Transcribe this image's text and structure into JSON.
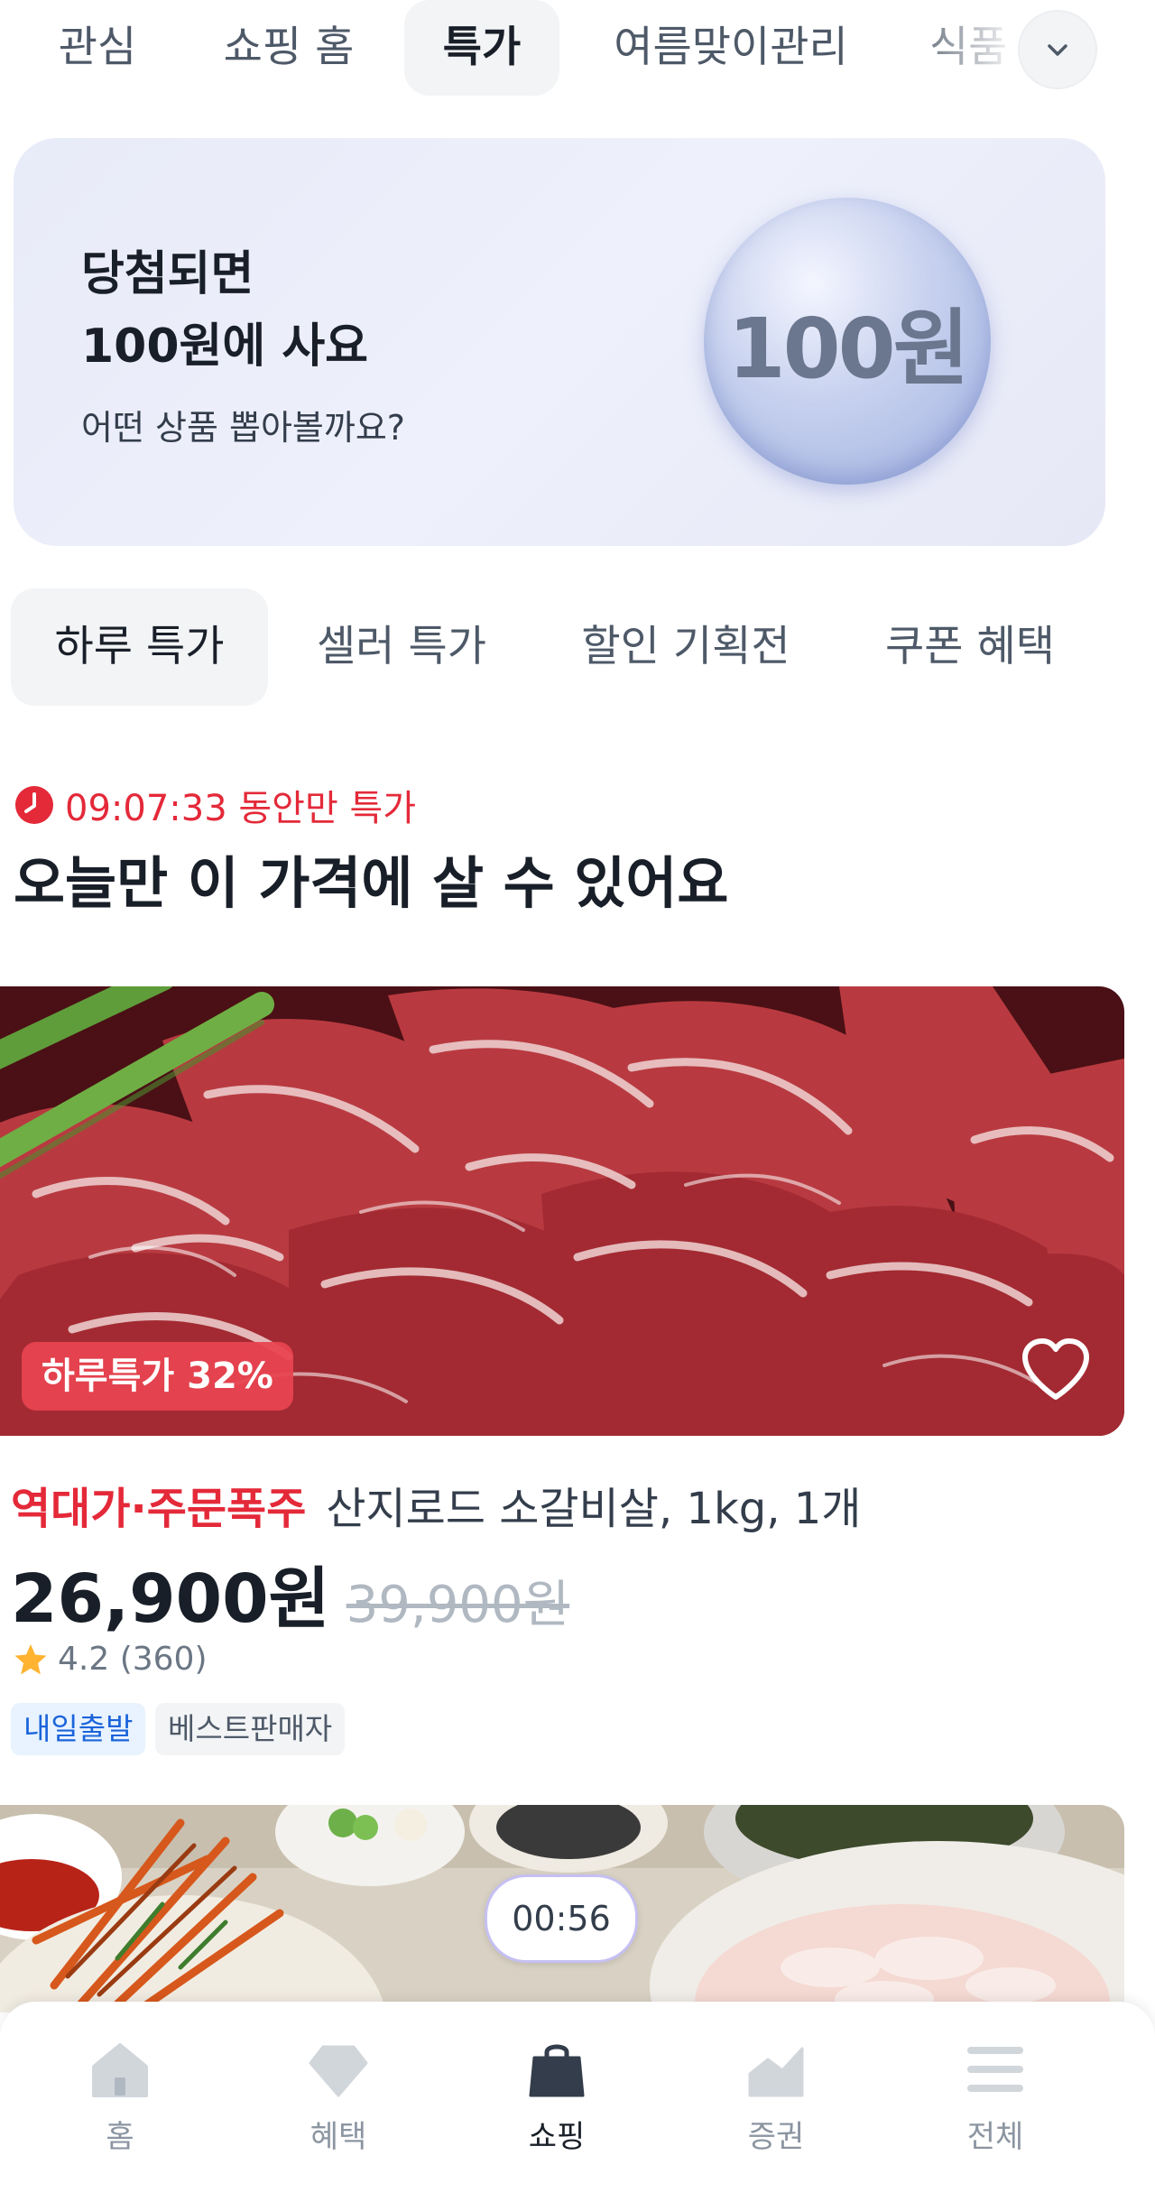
{
  "top_tabs": [
    {
      "label": "관심"
    },
    {
      "label": "쇼핑 홈"
    },
    {
      "label": "특가"
    },
    {
      "label": "여름맞이관리"
    },
    {
      "label": "식품"
    }
  ],
  "banner": {
    "line1": "당첨되면",
    "line2": "100원에 사요",
    "subtitle": "어떤 상품 뽑아볼까요?",
    "coin_text": "100원"
  },
  "sub_tabs": [
    {
      "label": "하루 특가"
    },
    {
      "label": "셀러 특가"
    },
    {
      "label": "할인 기획전"
    },
    {
      "label": "쿠폰 혜택"
    }
  ],
  "deal": {
    "timer_text": "09:07:33 동안만 특가",
    "title": "오늘만 이 가격에 살 수 있어요"
  },
  "product1": {
    "badge": "하루특가 32%",
    "highlight": "역대가·주문폭주",
    "name": "산지로드 소갈비살, 1kg, 1개",
    "price": "26,900원",
    "original_price": "39,900원",
    "rating_text": "4.2 (360)",
    "tags": [
      "내일출발",
      "베스트판매자"
    ]
  },
  "product2": {
    "video_timer": "00:56"
  },
  "bottom_nav": [
    {
      "label": "홈",
      "icon": "home-icon"
    },
    {
      "label": "혜택",
      "icon": "diamond-icon"
    },
    {
      "label": "쇼핑",
      "icon": "shopping-bag-icon"
    },
    {
      "label": "증권",
      "icon": "stock-chart-icon"
    },
    {
      "label": "전체",
      "icon": "menu-icon"
    }
  ],
  "colors": {
    "accent_red": "#e42939",
    "tag_blue": "#1b64da",
    "text_primary": "#191f28",
    "text_secondary": "#4e5968",
    "star": "#ffb331"
  }
}
